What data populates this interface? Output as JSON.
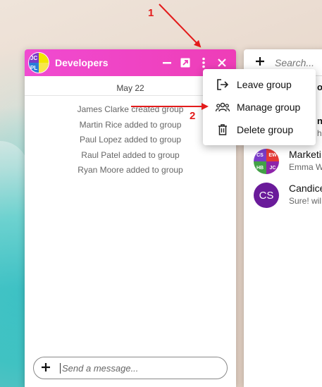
{
  "chat": {
    "title": "Developers",
    "avatar_initials": [
      "JC",
      "",
      "PL",
      ""
    ],
    "date": "May 22",
    "system_messages": [
      "James Clarke created group",
      "Martin Rice added to group",
      "Paul Lopez added to group",
      "Raul Patel added to group",
      "Ryan Moore added to group"
    ],
    "composer_placeholder": "Send a message..."
  },
  "menu": {
    "items": [
      {
        "label": "Leave group",
        "icon": "leave-icon"
      },
      {
        "label": "Manage group",
        "icon": "people-icon"
      },
      {
        "label": "Delete group",
        "icon": "trash-icon"
      }
    ]
  },
  "panel": {
    "search_placeholder": "Search...",
    "fragments": [
      "op",
      "n",
      "h"
    ],
    "conversations": [
      {
        "name": "Marketi",
        "preview": "Emma W",
        "initials": [
          "CS",
          "EW",
          "HB",
          "JC"
        ]
      },
      {
        "name": "Candice",
        "preview": "Sure! wil",
        "initials": "CS"
      }
    ]
  },
  "annotations": {
    "step1": "1",
    "step2": "2",
    "color": "#e31b1b"
  },
  "colors": {
    "header_gradient_start": "#f04bd1",
    "header_gradient_end": "#ee3db7"
  }
}
